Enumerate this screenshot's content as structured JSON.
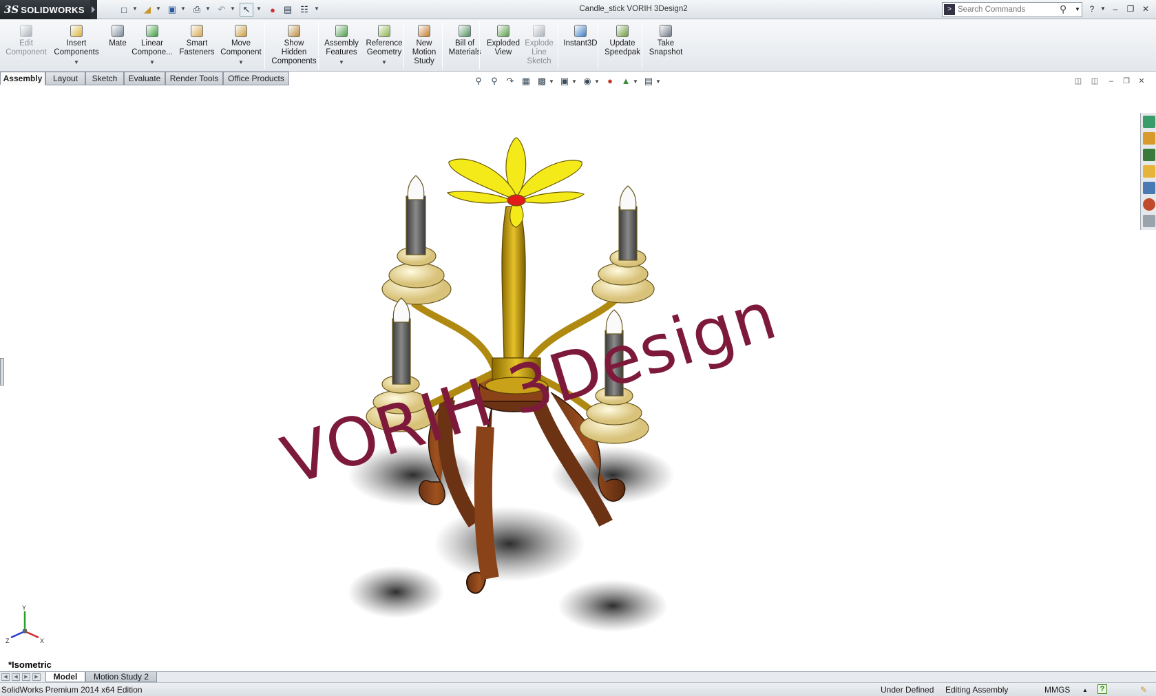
{
  "app": {
    "brand": "SOLIDWORKS",
    "ds_mark": "3S",
    "document_title": "Candle_stick VORIH 3Design2"
  },
  "search": {
    "placeholder": "Search Commands"
  },
  "command_manager": [
    {
      "id": "edit-component",
      "label": "Edit\nComponent",
      "icon": "edit-component-icon",
      "enabled": false,
      "dropdown": false,
      "color": "#a9b0b8"
    },
    {
      "id": "insert-components",
      "label": "Insert\nComponents",
      "icon": "insert-components-icon",
      "enabled": true,
      "dropdown": true,
      "color": "#d9b23a"
    },
    {
      "id": "mate",
      "label": "Mate",
      "icon": "mate-icon",
      "enabled": true,
      "dropdown": false,
      "color": "#7b8796"
    },
    {
      "id": "linear-component-pattern",
      "label": "Linear\nCompone...",
      "icon": "linear-pattern-icon",
      "enabled": true,
      "dropdown": true,
      "color": "#3a9c3a"
    },
    {
      "id": "smart-fasteners",
      "label": "Smart\nFasteners",
      "icon": "smart-fasteners-icon",
      "enabled": true,
      "dropdown": false,
      "color": "#d6a64a"
    },
    {
      "id": "move-component",
      "label": "Move\nComponent",
      "icon": "move-component-icon",
      "enabled": true,
      "dropdown": true,
      "color": "#c99a3a"
    },
    {
      "id": "show-hidden-components",
      "label": "Show\nHidden\nComponents",
      "icon": "show-hidden-components-icon",
      "enabled": true,
      "dropdown": false,
      "color": "#b98a3a"
    },
    {
      "id": "assembly-features",
      "label": "Assembly\nFeatures",
      "icon": "assembly-features-icon",
      "enabled": true,
      "dropdown": true,
      "color": "#4c9c4c"
    },
    {
      "id": "reference-geometry",
      "label": "Reference\nGeometry",
      "icon": "reference-geometry-icon",
      "enabled": true,
      "dropdown": true,
      "color": "#8bb34a"
    },
    {
      "id": "new-motion-study",
      "label": "New\nMotion\nStudy",
      "icon": "motion-study-icon",
      "enabled": true,
      "dropdown": false,
      "color": "#c47a2a"
    },
    {
      "id": "bill-of-materials",
      "label": "Bill of\nMaterials",
      "icon": "bill-of-materials-icon",
      "enabled": true,
      "dropdown": false,
      "color": "#4a8c5a"
    },
    {
      "id": "exploded-view",
      "label": "Exploded\nView",
      "icon": "exploded-view-icon",
      "enabled": true,
      "dropdown": false,
      "color": "#5a9a4a"
    },
    {
      "id": "explode-line-sketch",
      "label": "Explode\nLine\nSketch",
      "icon": "explode-line-sketch-icon",
      "enabled": false,
      "dropdown": false,
      "color": "#a9b0b8"
    },
    {
      "id": "instant3d",
      "label": "Instant3D",
      "icon": "instant3d-icon",
      "enabled": true,
      "dropdown": false,
      "color": "#3a7cc4"
    },
    {
      "id": "update-speedpak",
      "label": "Update\nSpeedpak",
      "icon": "speedpak-icon",
      "enabled": true,
      "dropdown": false,
      "color": "#6a9a3a"
    },
    {
      "id": "take-snapshot",
      "label": "Take\nSnapshot",
      "icon": "snapshot-icon",
      "enabled": true,
      "dropdown": false,
      "color": "#6c7480"
    }
  ],
  "tabs": [
    "Assembly",
    "Layout",
    "Sketch",
    "Evaluate",
    "Render Tools",
    "Office Products"
  ],
  "active_tab": "Assembly",
  "viewport": {
    "watermark": "VORIH 3Design",
    "view_name": "*Isometric",
    "triad_axes": [
      "Y",
      "Z",
      "X"
    ]
  },
  "bottom_tabs": [
    "Model",
    "Motion Study 2"
  ],
  "active_bottom_tab": "Model",
  "status": {
    "edition": "SolidWorks Premium 2014 x64 Edition",
    "definition": "Under Defined",
    "mode": "Editing Assembly",
    "units": "MMGS"
  }
}
